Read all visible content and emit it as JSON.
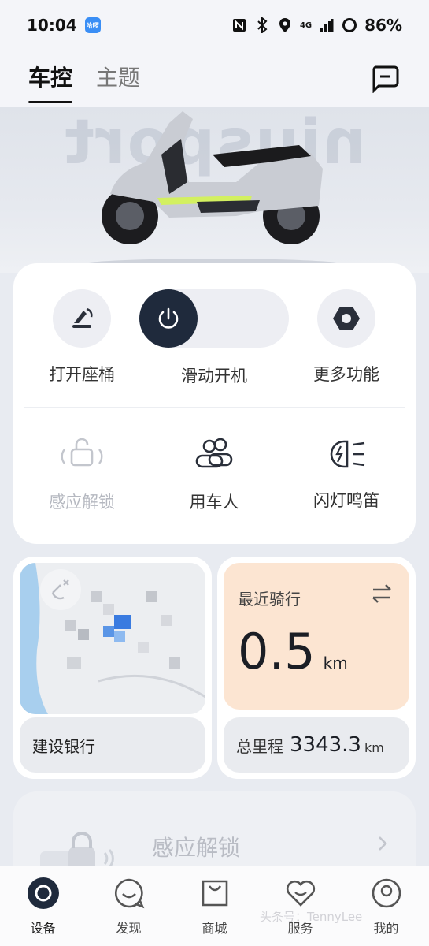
{
  "status": {
    "time": "10:04",
    "app_badge": "哈啰",
    "network": "4G",
    "battery": "86%"
  },
  "tabs": [
    {
      "label": "车控"
    },
    {
      "label": "主题"
    }
  ],
  "hero": {
    "watermark": "niusport"
  },
  "controls": {
    "open_seat": "打开座桶",
    "slide_start": "滑动开机",
    "more": "更多功能",
    "sense_unlock": "感应解锁",
    "users": "用车人",
    "flash_horn": "闪灯鸣笛"
  },
  "map": {
    "location": "建设银行"
  },
  "ride": {
    "title": "最近骑行",
    "value": "0.5",
    "unit": "km"
  },
  "odometer": {
    "label": "总里程",
    "value": "3343.3",
    "unit": "km"
  },
  "promo": {
    "label": "感应解锁"
  },
  "watermark_text": "头条号：TennyLee",
  "bottom_nav": [
    {
      "label": "设备"
    },
    {
      "label": "发现"
    },
    {
      "label": "商城"
    },
    {
      "label": "服务"
    },
    {
      "label": "我的"
    }
  ]
}
